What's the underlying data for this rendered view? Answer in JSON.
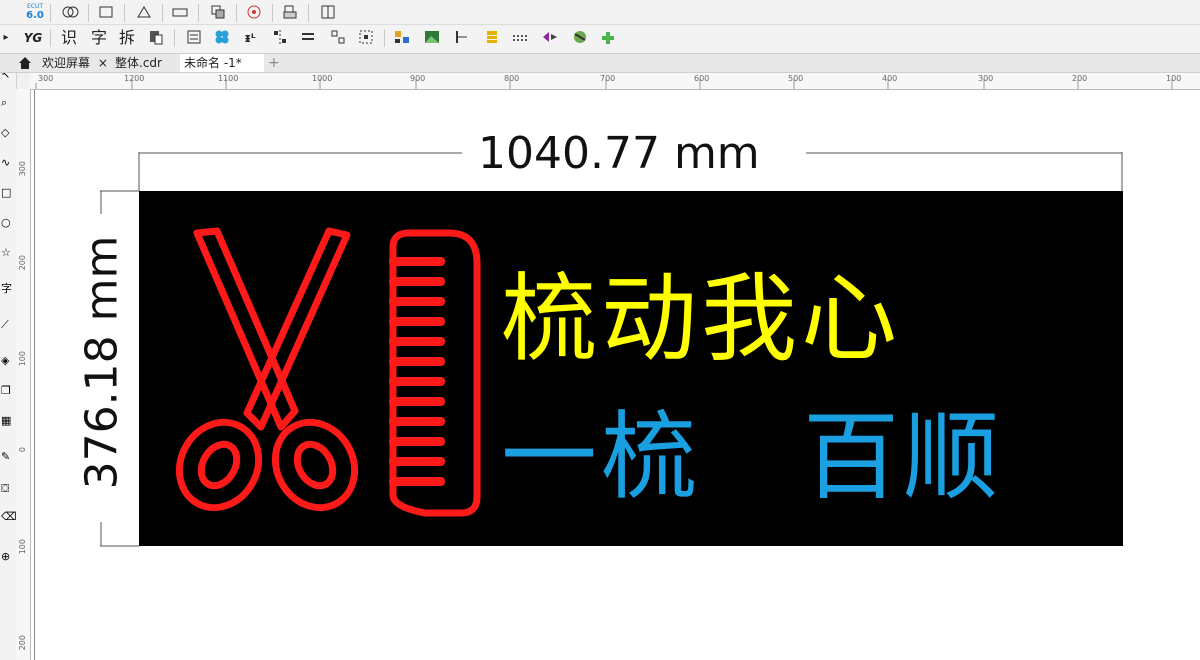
{
  "toolbar_top": {
    "version_label": "6.0",
    "version_prefix": "ECUT"
  },
  "toolbar_main": {
    "yg_label": "YG",
    "recognize_label": "识",
    "char_label": "字",
    "split_label": "拆"
  },
  "tabs": [
    {
      "label": "欢迎屏幕",
      "close": "×"
    },
    {
      "label": "整体.cdr"
    },
    {
      "label": "未命名 -1*"
    },
    {
      "label": "+"
    }
  ],
  "ruler_h_ticks": [
    "300",
    "1200",
    "1100",
    "1000",
    "900",
    "800",
    "700",
    "600",
    "500",
    "400",
    "300",
    "200",
    "100"
  ],
  "ruler_v_ticks": [
    "300",
    "200",
    "100",
    "0",
    "100",
    "200"
  ],
  "dimension": {
    "width_text": "1040.77 mm",
    "height_text": "376.18 mm"
  },
  "sign": {
    "line1": "梳动我心",
    "line2_part1": "一梳",
    "line2_part2": "百顺",
    "colors": {
      "background": "#000000",
      "scissors": "#ff1a1a",
      "comb": "#ff1a1a",
      "line1": "#ffff00",
      "line2": "#1a9fe0"
    }
  },
  "icons": [
    "home-icon",
    "scissors-icon",
    "comb-icon"
  ]
}
